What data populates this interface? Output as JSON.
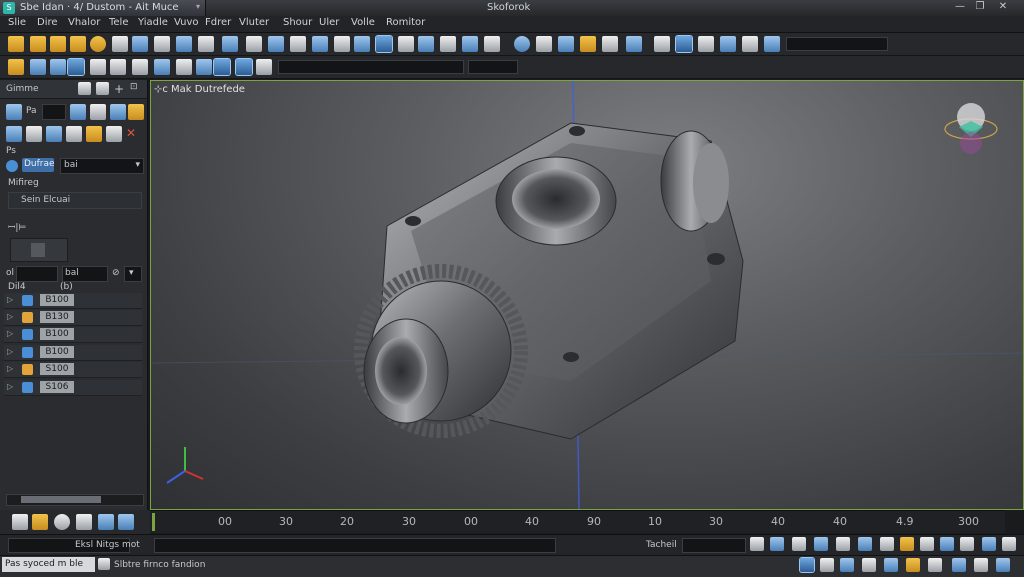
{
  "window": {
    "doc_title": "Sbe Idan · 4/ Dustom - Ait Muce",
    "title": "Skoforok",
    "buttons": {
      "minimize": "—",
      "maximize": "❐",
      "close": "✕"
    }
  },
  "menu": [
    "Slie",
    "Dire",
    "Vhalor",
    "Tele",
    "Yiadle",
    "Vuvo",
    "Fdrer",
    "Vluter",
    "Shour",
    "Uler",
    "Volle",
    "Romitor"
  ],
  "panel": {
    "head_label": "Gimme",
    "mode_label": "Pa",
    "dropdown_label": "Dufrae",
    "dropdown_value": "bai",
    "section_label": "Mifireg",
    "button_label": "Sein Elcuai",
    "pin_label": "ꟷ|⊨",
    "anim_left_label": "ol",
    "anim_field": "",
    "anim_right_label": "bal",
    "anim_sub_left": "Dil4",
    "anim_sub_right": "(b)",
    "keys": [
      {
        "value": "B100",
        "color": "#4a8fd6"
      },
      {
        "value": "B130",
        "color": "#e3a33a"
      },
      {
        "value": "B100",
        "color": "#4a8fd6"
      },
      {
        "value": "B100",
        "color": "#4a8fd6"
      },
      {
        "value": "S100",
        "color": "#e3a33a"
      },
      {
        "value": "S106",
        "color": "#4a8fd6"
      }
    ]
  },
  "viewport": {
    "label": "⊹c Mak Dutrefede"
  },
  "timeline": {
    "ticks": [
      "00",
      "30",
      "20",
      "30",
      "00",
      "40",
      "90",
      "10",
      "30",
      "40",
      "40",
      "4.9",
      "300"
    ]
  },
  "bottombar": {
    "field_label": "Eksl Nitgs mot",
    "right_label": "Tacheil"
  },
  "status": {
    "box_text": "Pas syoced m ble",
    "message": "Slbtre firnco fandion"
  },
  "colors": {
    "accent_green": "#7aa43f",
    "icon_yellow": "#f2c34a",
    "icon_blue": "#6fa8e0",
    "axis_x": "#d43030",
    "axis_y": "#3fbf3f",
    "axis_z": "#3f5fe0"
  }
}
